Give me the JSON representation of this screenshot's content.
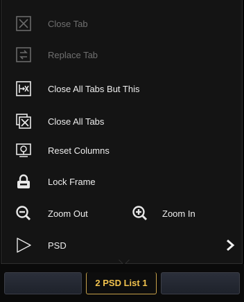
{
  "menu": {
    "items": [
      {
        "label": "Close Tab",
        "icon": "close-tab-icon",
        "enabled": false
      },
      {
        "label": "Replace Tab",
        "icon": "replace-tab-icon",
        "enabled": false
      },
      {
        "label": "Close All Tabs But This",
        "icon": "close-others-icon",
        "enabled": true
      },
      {
        "label": "Close All Tabs",
        "icon": "close-all-icon",
        "enabled": true
      },
      {
        "label": "Reset Columns",
        "icon": "reset-columns-icon",
        "enabled": true
      },
      {
        "label": "Lock Frame",
        "icon": "lock-icon",
        "enabled": true
      }
    ],
    "zoom_out_label": "Zoom Out",
    "zoom_in_label": "Zoom In",
    "psd_label": "PSD"
  },
  "tabs": {
    "active_label": "2 PSD List 1"
  },
  "colors": {
    "menu_bg": "#141414",
    "text": "#eeeeee",
    "disabled_text": "#707070",
    "active_tab_text": "#f2c34e",
    "active_tab_border": "#c8a24a"
  }
}
